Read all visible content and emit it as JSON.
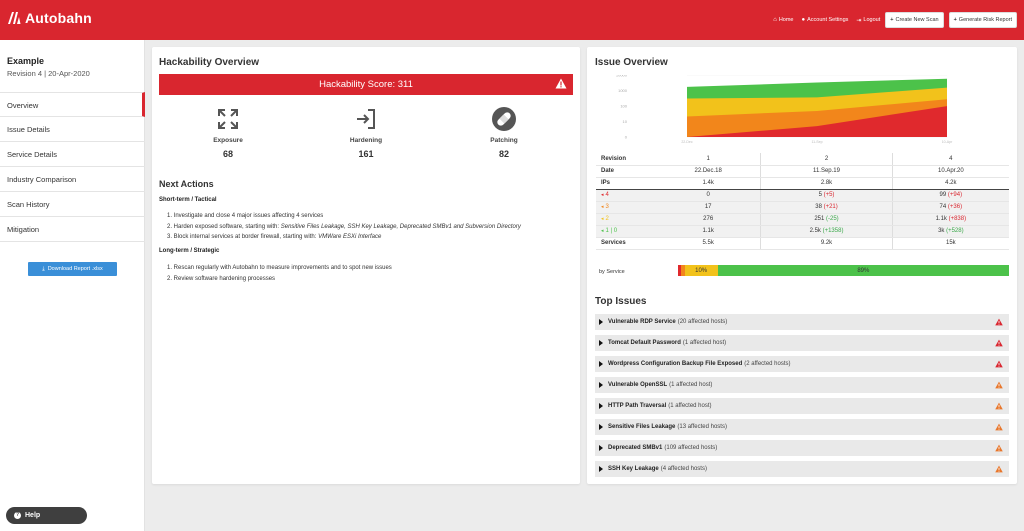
{
  "header": {
    "brand": "Autobahn",
    "nav": [
      {
        "icon": "home-icon",
        "label": "Home"
      },
      {
        "icon": "user-icon",
        "label": "Account Settings"
      },
      {
        "icon": "logout-icon",
        "label": "Logout"
      }
    ],
    "create_scan": "Create New Scan",
    "risk_report": "Generate Risk Report"
  },
  "sidebar": {
    "title": "Example",
    "revision": "Revision 4 | 20-Apr-2020",
    "items": [
      {
        "label": "Overview"
      },
      {
        "label": "Issue Details"
      },
      {
        "label": "Service Details"
      },
      {
        "label": "Industry Comparison"
      },
      {
        "label": "Scan History"
      },
      {
        "label": "Mitigation"
      }
    ],
    "download": "Download Report .xlsx",
    "help": "Help"
  },
  "hackability": {
    "title": "Hackability Overview",
    "score_label": "Hackability Score: 311",
    "metrics": [
      {
        "label": "Exposure",
        "value": "68",
        "icon": "expand-arrows-icon"
      },
      {
        "label": "Hardening",
        "value": "161",
        "icon": "sign-in-icon"
      },
      {
        "label": "Patching",
        "value": "82",
        "icon": "bandage-icon"
      }
    ]
  },
  "next_actions": {
    "title": "Next Actions",
    "short_term": {
      "title": "Short-term / Tactical",
      "items": [
        {
          "pre": "1. Investigate and close 4 major issues affecting 4 services",
          "em": ""
        },
        {
          "pre": "2. Harden exposed software, starting with: ",
          "em": "Sensitive Files Leakage, SSH Key Leakage, Deprecated SMBv1 and Subversion Directory"
        },
        {
          "pre": "3. Block internal services at border firewall, starting with: ",
          "em": "VMWare ESXi Interface"
        }
      ]
    },
    "long_term": {
      "title": "Long-term / Strategic",
      "items": [
        {
          "pre": "1. Rescan regularly with Autobahn to measure improvements and to spot new issues",
          "em": ""
        },
        {
          "pre": "2. Review software hardening processes",
          "em": ""
        }
      ]
    }
  },
  "issue_overview": {
    "title": "Issue Overview",
    "chart_data": {
      "type": "area",
      "y_log_ticks": [
        "10000",
        "1000",
        "100",
        "10",
        "0"
      ],
      "x_ticks": [
        "22-Dec",
        "11-Sep",
        "10-Apr"
      ],
      "series": [
        {
          "color": "#4cc24a",
          "values": [
            1400,
            2900,
            4200
          ]
        },
        {
          "color": "#f2c21b",
          "values": [
            282,
            312,
            1274
          ]
        },
        {
          "color": "#f2861b",
          "values": [
            21,
            43,
            173
          ]
        },
        {
          "color": "#e0292d",
          "values": [
            0,
            5,
            99
          ]
        }
      ]
    },
    "table": {
      "revision": {
        "label": "Revision",
        "values": [
          "1",
          "2",
          "4"
        ]
      },
      "date": {
        "label": "Date",
        "values": [
          "22.Dec.18",
          "11.Sep.19",
          "10.Apr.20"
        ]
      },
      "ips": {
        "label": "IPs",
        "values": [
          "1.4k",
          "2.8k",
          "4.2k"
        ]
      },
      "severity_rows": [
        {
          "label": "4",
          "color": "#e0292d",
          "v1": "0",
          "v2": "5",
          "d2": "(+5)",
          "d2c": "up",
          "v3": "99",
          "d3": "(+94)",
          "d3c": "up"
        },
        {
          "label": "3",
          "color": "#f2861b",
          "v1": "17",
          "v2": "38",
          "d2": "(+21)",
          "d2c": "up",
          "v3": "74",
          "d3": "(+36)",
          "d3c": "up"
        },
        {
          "label": "2",
          "color": "#f2c21b",
          "v1": "276",
          "v2": "251",
          "d2": "(-25)",
          "d2c": "down",
          "v3": "1.1k",
          "d3": "(+838)",
          "d3c": "up"
        },
        {
          "label": "1 | 0",
          "color": "#4cc24a",
          "v1": "1.1k",
          "v2": "2.5k",
          "d2": "(+1358)",
          "d2c": "down",
          "v3": "3k",
          "d3": "(+528)",
          "d3c": "down"
        }
      ],
      "services": {
        "label": "Services",
        "values": [
          "5.5k",
          "9.2k",
          "15k"
        ]
      }
    },
    "by_service": {
      "label": "by Service",
      "segments": [
        {
          "color": "#e0292d",
          "pct": 1
        },
        {
          "color": "#f2861b",
          "pct": 1
        },
        {
          "color": "#f2c21b",
          "pct": 10,
          "text": "10%"
        },
        {
          "color": "#4cc24a",
          "pct": 88,
          "text": "89%"
        }
      ]
    }
  },
  "top_issues": {
    "title": "Top Issues",
    "items": [
      {
        "name": "Vulnerable RDP Service",
        "affected": "(20 affected hosts)",
        "color": "#d9262f"
      },
      {
        "name": "Tomcat Default Password",
        "affected": "(1 affected host)",
        "color": "#d9262f"
      },
      {
        "name": "Wordpress Configuration Backup File Exposed",
        "affected": "(2 affected hosts)",
        "color": "#d9262f"
      },
      {
        "name": "Vulnerable OpenSSL",
        "affected": "(1 affected host)",
        "color": "#e8762b"
      },
      {
        "name": "HTTP Path Traversal",
        "affected": "(1 affected host)",
        "color": "#e8762b"
      },
      {
        "name": "Sensitive Files Leakage",
        "affected": "(13 affected hosts)",
        "color": "#e8762b"
      },
      {
        "name": "Deprecated SMBv1",
        "affected": "(109 affected hosts)",
        "color": "#e8762b"
      },
      {
        "name": "SSH Key Leakage",
        "affected": "(4 affected hosts)",
        "color": "#e8762b"
      }
    ]
  }
}
